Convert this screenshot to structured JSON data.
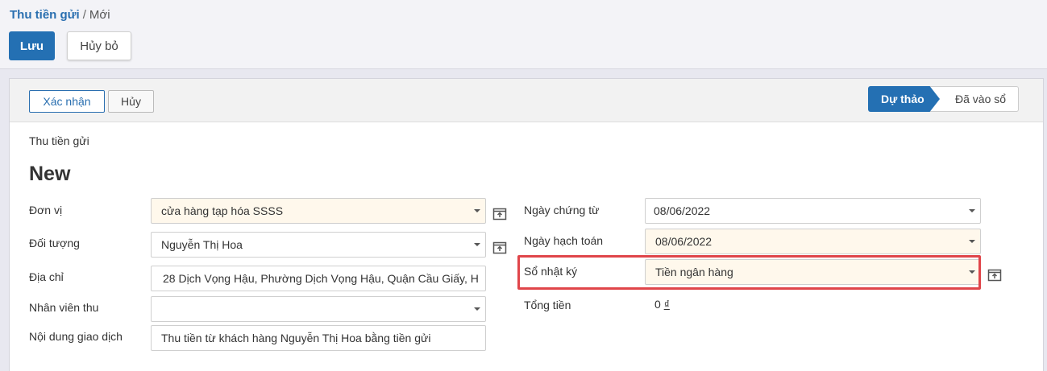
{
  "breadcrumb": {
    "parent": "Thu tiền gửi",
    "separator": "/",
    "current": "Mới"
  },
  "toolbar": {
    "save_label": "Lưu",
    "discard_label": "Hủy bỏ"
  },
  "statusbar": {
    "confirm_label": "Xác nhận",
    "cancel_label": "Hủy",
    "stages": [
      "Dự thảo",
      "Đã vào sổ"
    ],
    "active_stage": "Dự thảo"
  },
  "form": {
    "subtitle": "Thu tiền gửi",
    "title": "New",
    "left": {
      "unit_label": "Đơn vị",
      "unit_value": "cửa hàng tạp hóa SSSS",
      "partner_label": "Đối tượng",
      "partner_value": "Nguyễn Thị Hoa",
      "address_label": "Địa chỉ",
      "address_value": "28 Dịch Vọng Hậu, Phường Dịch Vọng Hậu, Quận Cầu Giấy, H",
      "collector_label": "Nhân viên thu",
      "collector_value": "",
      "description_label": "Nội dung giao dịch",
      "description_value": "Thu tiền từ khách hàng Nguyễn Thị Hoa bằng tiền gửi"
    },
    "right": {
      "doc_date_label": "Ngày chứng từ",
      "doc_date_value": "08/06/2022",
      "accounting_date_label": "Ngày hạch toán",
      "accounting_date_value": "08/06/2022",
      "journal_label": "Sổ nhật ký",
      "journal_value": "Tiền ngân hàng",
      "total_label": "Tổng tiền",
      "total_value": "0",
      "currency_symbol": "₫"
    }
  },
  "colors": {
    "primary": "#2470b3",
    "highlight": "#e0454a",
    "required_bg": "#fff8ec"
  }
}
